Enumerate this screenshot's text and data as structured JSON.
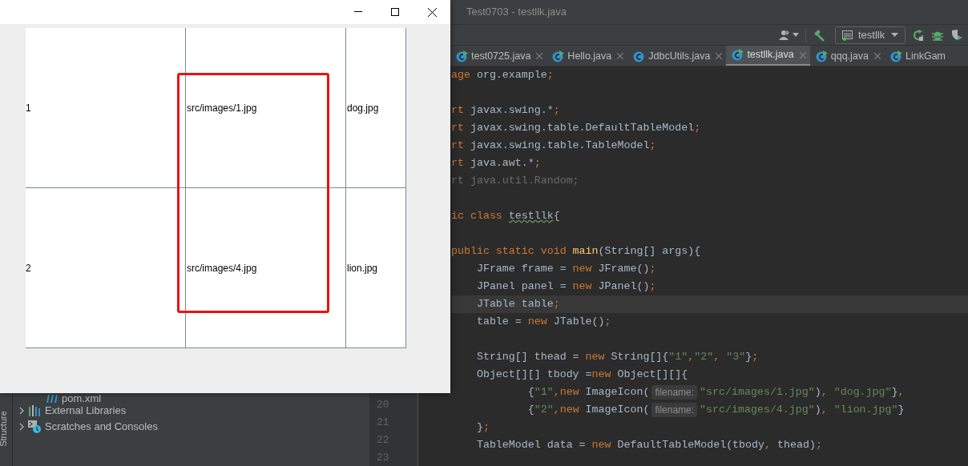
{
  "ide": {
    "title": "Test0703 - testllk.java",
    "run_config": {
      "label": "testllk"
    },
    "tabs": [
      {
        "label": "test0725.java",
        "selected": false,
        "kind": "runnable",
        "closable": true
      },
      {
        "label": "Hello.java",
        "selected": false,
        "kind": "runnable",
        "closable": true
      },
      {
        "label": "JdbcUtils.java",
        "selected": false,
        "kind": "class",
        "closable": true
      },
      {
        "label": "testllk.java",
        "selected": true,
        "kind": "runnable",
        "closable": true
      },
      {
        "label": "qqq.java",
        "selected": false,
        "kind": "runnable",
        "closable": true
      },
      {
        "label": "LinkGam",
        "selected": false,
        "kind": "runnable",
        "closable": false
      }
    ],
    "side_stripe": {
      "label": "Structure"
    },
    "project_tree": [
      {
        "label": "pom.xml",
        "kind": "maven",
        "expandable": false
      },
      {
        "label": "External Libraries",
        "kind": "libraries",
        "expandable": true
      },
      {
        "label": "Scratches and Consoles",
        "kind": "scratches",
        "expandable": true
      }
    ],
    "code_lines": [
      {
        "current": false,
        "tokens": [
          {
            "text": "age",
            "kind": "keyword"
          },
          {
            "text": " org.example",
            "kind": "plain"
          },
          {
            "text": ";",
            "kind": "keyword"
          }
        ]
      },
      {
        "current": false
      },
      {
        "current": false,
        "tokens": [
          {
            "text": "rt",
            "kind": "keyword"
          },
          {
            "text": " javax.swing.*",
            "kind": "plain"
          },
          {
            "text": ";",
            "kind": "keyword"
          }
        ]
      },
      {
        "current": false,
        "tokens": [
          {
            "text": "rt",
            "kind": "keyword"
          },
          {
            "text": " javax.swing.table.DefaultTableModel",
            "kind": "plain"
          },
          {
            "text": ";",
            "kind": "keyword"
          }
        ]
      },
      {
        "current": false,
        "tokens": [
          {
            "text": "rt",
            "kind": "keyword"
          },
          {
            "text": " javax.swing.table.TableModel",
            "kind": "plain"
          },
          {
            "text": ";",
            "kind": "keyword"
          }
        ]
      },
      {
        "current": false,
        "tokens": [
          {
            "text": "rt",
            "kind": "keyword"
          },
          {
            "text": " java.awt.*",
            "kind": "plain"
          },
          {
            "text": ";",
            "kind": "keyword"
          }
        ]
      },
      {
        "current": false,
        "tokens": [
          {
            "text": "rt java.util.Random;",
            "kind": "unused"
          }
        ]
      },
      {
        "current": false
      },
      {
        "current": false,
        "tokens": [
          {
            "text": "ic class ",
            "kind": "keyword"
          },
          {
            "text": "testllk",
            "kind": "typo"
          },
          {
            "text": "{",
            "kind": "plain"
          }
        ]
      },
      {
        "current": false
      },
      {
        "current": false,
        "tokens": [
          {
            "text": "public static void ",
            "kind": "keyword"
          },
          {
            "text": "main",
            "kind": "method"
          },
          {
            "text": "(String[] args){",
            "kind": "plain"
          }
        ]
      },
      {
        "current": false,
        "tokens": [
          {
            "text": "    JFrame frame = ",
            "kind": "plain"
          },
          {
            "text": "new",
            "kind": "keyword"
          },
          {
            "text": " JFrame()",
            "kind": "plain"
          },
          {
            "text": ";",
            "kind": "keyword"
          }
        ]
      },
      {
        "current": false,
        "tokens": [
          {
            "text": "    JPanel panel = ",
            "kind": "plain"
          },
          {
            "text": "new",
            "kind": "keyword"
          },
          {
            "text": " JPanel()",
            "kind": "plain"
          },
          {
            "text": ";",
            "kind": "keyword"
          }
        ]
      },
      {
        "current": true,
        "tokens": [
          {
            "text": "    JTable table",
            "kind": "plain"
          },
          {
            "text": ";",
            "kind": "keyword"
          }
        ]
      },
      {
        "current": false,
        "tokens": [
          {
            "text": "    table = ",
            "kind": "plain"
          },
          {
            "text": "new",
            "kind": "keyword"
          },
          {
            "text": " JTable()",
            "kind": "plain"
          },
          {
            "text": ";",
            "kind": "keyword"
          }
        ]
      },
      {
        "current": false
      },
      {
        "current": false,
        "tokens": [
          {
            "text": "    String[] thead = ",
            "kind": "plain"
          },
          {
            "text": "new",
            "kind": "keyword"
          },
          {
            "text": " String[]{",
            "kind": "plain"
          },
          {
            "text": "\"1\"",
            "kind": "string"
          },
          {
            "text": ",",
            "kind": "keyword"
          },
          {
            "text": "\"2\"",
            "kind": "string"
          },
          {
            "text": ", ",
            "kind": "keyword"
          },
          {
            "text": "\"3\"",
            "kind": "string"
          },
          {
            "text": "}",
            "kind": "plain"
          },
          {
            "text": ";",
            "kind": "keyword"
          }
        ]
      },
      {
        "current": false,
        "tokens": [
          {
            "text": "    Object[][] tbody =",
            "kind": "plain"
          },
          {
            "text": "new",
            "kind": "keyword"
          },
          {
            "text": " Object[][]{",
            "kind": "plain"
          }
        ]
      },
      {
        "current": false,
        "tokens": [
          {
            "text": "            {",
            "kind": "plain"
          },
          {
            "text": "\"1\"",
            "kind": "string"
          },
          {
            "text": ",",
            "kind": "keyword"
          },
          {
            "text": "new",
            "kind": "keyword"
          },
          {
            "text": " ImageIcon(",
            "kind": "plain"
          },
          {
            "text": "filename:",
            "kind": "hint"
          },
          {
            "text": "\"src/images/1.jpg\"",
            "kind": "string"
          },
          {
            "text": ")",
            "kind": "plain"
          },
          {
            "text": ", ",
            "kind": "keyword"
          },
          {
            "text": "\"dog.jpg\"",
            "kind": "string"
          },
          {
            "text": "}",
            "kind": "plain"
          },
          {
            "text": ",",
            "kind": "keyword"
          }
        ]
      },
      {
        "current": false,
        "number": "20",
        "tokens": [
          {
            "text": "            {",
            "kind": "plain"
          },
          {
            "text": "\"2\"",
            "kind": "string"
          },
          {
            "text": ",",
            "kind": "keyword"
          },
          {
            "text": "new",
            "kind": "keyword"
          },
          {
            "text": " ImageIcon(",
            "kind": "plain"
          },
          {
            "text": "filename:",
            "kind": "hint"
          },
          {
            "text": "\"src/images/4.jpg\"",
            "kind": "string"
          },
          {
            "text": ")",
            "kind": "plain"
          },
          {
            "text": ", ",
            "kind": "keyword"
          },
          {
            "text": "\"lion.jpg\"",
            "kind": "string"
          },
          {
            "text": "}",
            "kind": "plain"
          }
        ]
      },
      {
        "current": false,
        "number": "21",
        "tokens": [
          {
            "text": "    }",
            "kind": "plain"
          },
          {
            "text": ";",
            "kind": "keyword"
          }
        ]
      },
      {
        "current": false,
        "number": "22",
        "tokens": [
          {
            "text": "    TableModel data = ",
            "kind": "plain"
          },
          {
            "text": "new",
            "kind": "keyword"
          },
          {
            "text": " DefaultTableModel(tbody",
            "kind": "plain"
          },
          {
            "text": ",",
            "kind": "keyword"
          },
          {
            "text": " thead)",
            "kind": "plain"
          },
          {
            "text": ";",
            "kind": "keyword"
          }
        ]
      },
      {
        "current": false,
        "number": "23"
      }
    ]
  },
  "swing_window": {
    "rows": [
      [
        "1",
        "src/images/1.jpg",
        "dog.jpg"
      ],
      [
        "2",
        "src/images/4.jpg",
        "lion.jpg"
      ]
    ]
  }
}
